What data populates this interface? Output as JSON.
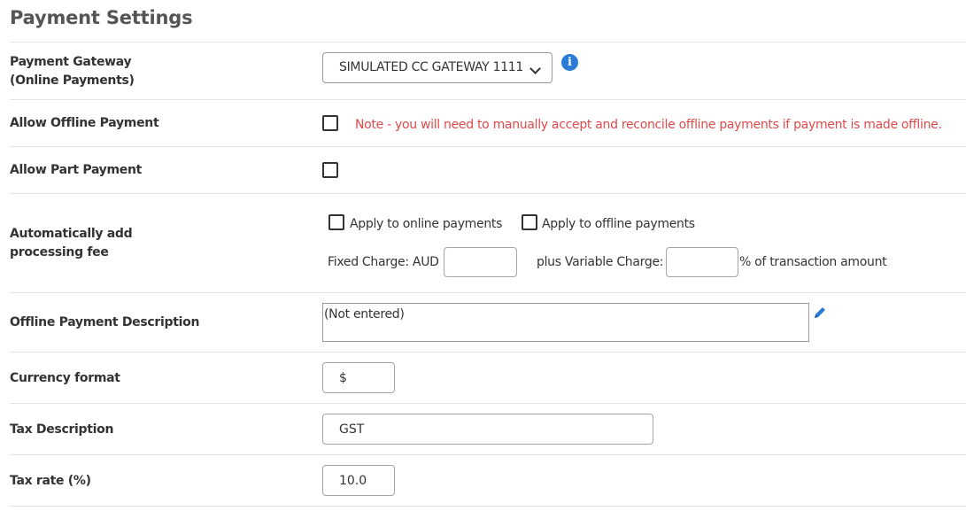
{
  "page": {
    "title": "Payment Settings"
  },
  "colors": {
    "accent": "#2b7bd6",
    "note": "#e04a4a"
  },
  "gateway": {
    "label_line1": "Payment Gateway",
    "label_line2": "(Online Payments)",
    "selected": "SIMULATED CC GATEWAY 1111",
    "icon": "info-icon"
  },
  "offline_payment": {
    "label": "Allow Offline Payment",
    "checked": false,
    "note": "Note - you will need to manually accept and reconcile offline payments if payment is made offline."
  },
  "part_payment": {
    "label": "Allow Part Payment",
    "checked": false
  },
  "processing_fee": {
    "label_line1": "Automatically add",
    "label_line2": "processing fee",
    "online_label": "Apply to online payments",
    "offline_label": "Apply to offline payments",
    "fixed_label": "Fixed Charge: AUD",
    "fixed_value": "",
    "variable_label": "plus Variable Charge:",
    "variable_value": "",
    "variable_suffix": "% of transaction amount"
  },
  "offline_description": {
    "label": "Offline Payment Description",
    "value": "(Not entered)",
    "icon": "pencil-icon"
  },
  "currency_format": {
    "label": "Currency format",
    "value": "$"
  },
  "tax_description": {
    "label": "Tax Description",
    "value": "GST"
  },
  "tax_rate": {
    "label": "Tax rate (%)",
    "value": "10.0"
  }
}
